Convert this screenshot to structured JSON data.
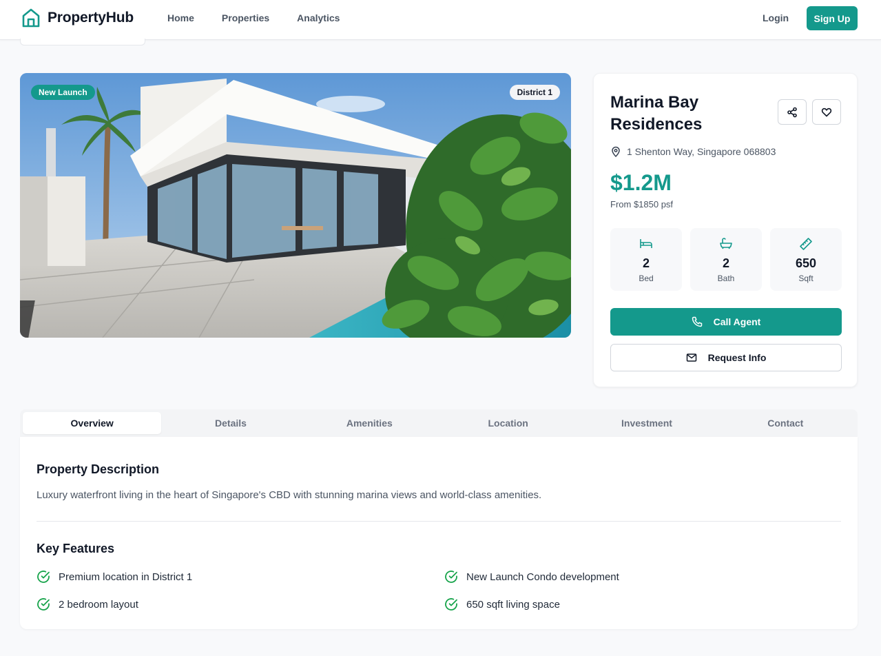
{
  "nav": {
    "brand": "PropertyHub",
    "links": [
      "Home",
      "Properties",
      "Analytics"
    ],
    "login": "Login",
    "signup": "Sign Up"
  },
  "hero": {
    "badge_new": "New Launch",
    "badge_district": "District 1"
  },
  "property": {
    "title": "Marina Bay Residences",
    "address": "1 Shenton Way, Singapore 068803",
    "price": "$1.2M",
    "psf": "From $1850 psf",
    "stats": [
      {
        "value": "2",
        "label": "Bed",
        "icon": "bed-icon"
      },
      {
        "value": "2",
        "label": "Bath",
        "icon": "bath-icon"
      },
      {
        "value": "650",
        "label": "Sqft",
        "icon": "ruler-icon"
      }
    ],
    "call_label": "Call Agent",
    "request_label": "Request Info"
  },
  "tabs": [
    "Overview",
    "Details",
    "Amenities",
    "Location",
    "Investment",
    "Contact"
  ],
  "overview": {
    "desc_heading": "Property Description",
    "description": "Luxury waterfront living in the heart of Singapore's CBD with stunning marina views and world-class amenities.",
    "features_heading": "Key Features",
    "features": [
      "Premium location in District 1",
      "New Launch Condo development",
      "2 bedroom layout",
      "650 sqft living space"
    ]
  },
  "colors": {
    "accent": "#14998c",
    "text": "#111827",
    "muted": "#4b5563",
    "check": "#16a34a"
  }
}
